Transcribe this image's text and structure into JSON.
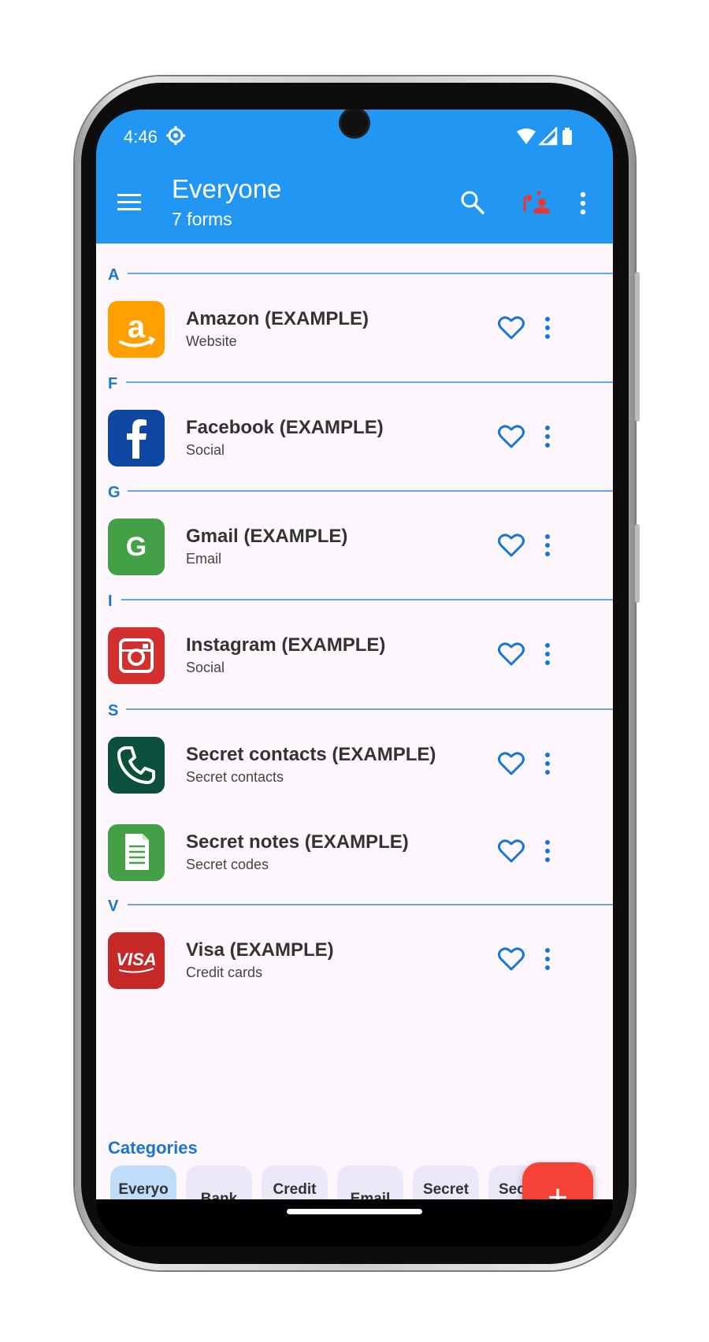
{
  "status_bar": {
    "time": "4:46"
  },
  "app_bar": {
    "title": "Everyone",
    "subtitle": "7 forms"
  },
  "sections": [
    {
      "letter": "A"
    },
    {
      "letter": "F"
    },
    {
      "letter": "G"
    },
    {
      "letter": "I"
    },
    {
      "letter": "S"
    },
    {
      "letter": "V"
    }
  ],
  "items": [
    {
      "title": "Amazon (EXAMPLE)",
      "subtitle": "Website",
      "icon": "amazon-icon",
      "color": "#ff9900"
    },
    {
      "title": "Facebook (EXAMPLE)",
      "subtitle": "Social",
      "icon": "facebook-icon",
      "color": "#0d47a1"
    },
    {
      "title": "Gmail (EXAMPLE)",
      "subtitle": "Email",
      "icon": "gmail-icon",
      "color": "#43a047"
    },
    {
      "title": "Instagram (EXAMPLE)",
      "subtitle": "Social",
      "icon": "instagram-icon",
      "color": "#d32f2f"
    },
    {
      "title": "Secret contacts (EXAMPLE)",
      "subtitle": "Secret contacts",
      "icon": "phone-icon",
      "color": "#0b4f3c"
    },
    {
      "title": "Secret notes (EXAMPLE)",
      "subtitle": "Secret codes",
      "icon": "notes-icon",
      "color": "#43a047"
    },
    {
      "title": "Visa (EXAMPLE)",
      "subtitle": "Credit cards",
      "icon": "visa-icon",
      "color": "#c62828"
    }
  ],
  "categories": {
    "title": "Categories",
    "chips": [
      {
        "label": "Everyone",
        "active": true
      },
      {
        "label": "Bank"
      },
      {
        "label": "Credit cards"
      },
      {
        "label": "Email"
      },
      {
        "label": "Secret codes"
      },
      {
        "label": "Secret contacts"
      }
    ]
  },
  "fab": {
    "label": "+"
  },
  "colors": {
    "primary": "#2196f3",
    "accent": "#f44336",
    "link": "#1976d2"
  }
}
